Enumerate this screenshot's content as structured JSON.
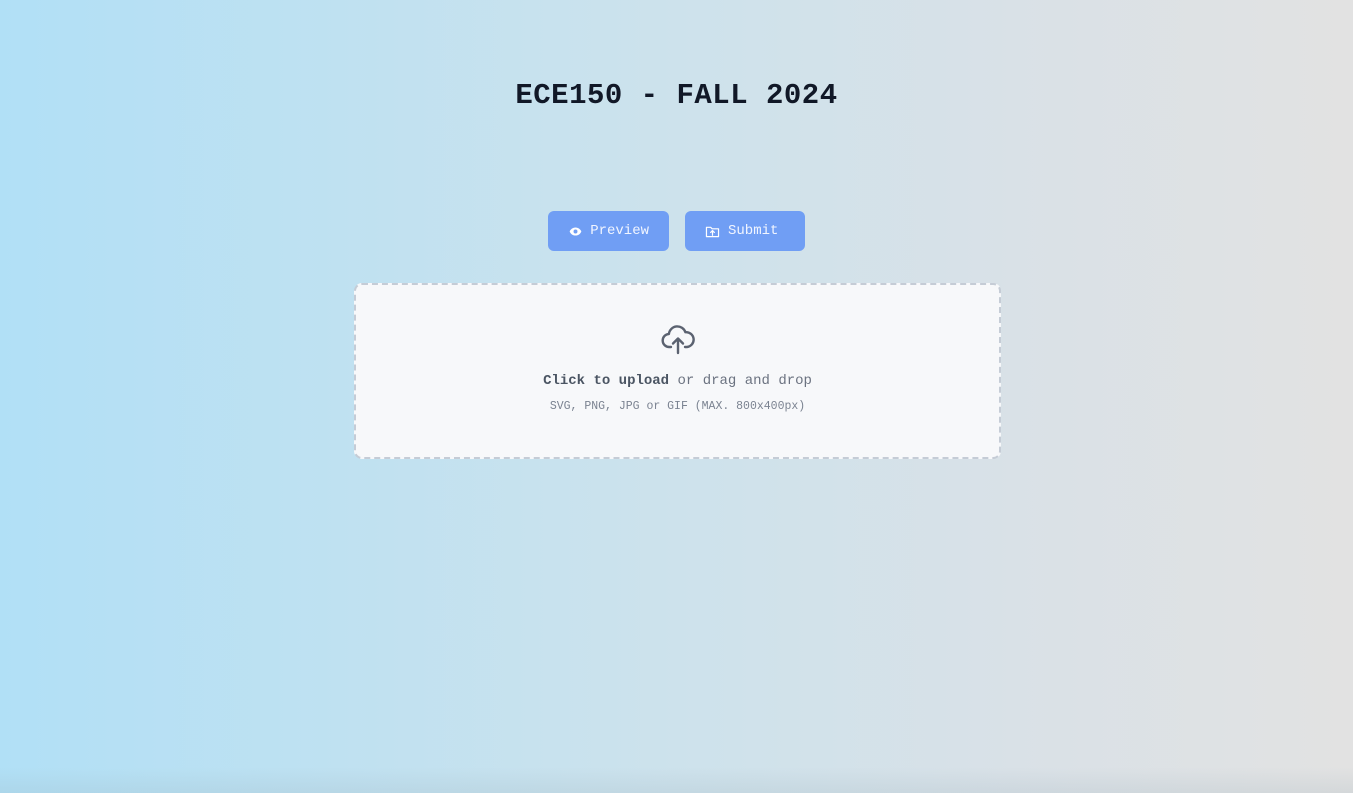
{
  "header": {
    "title": "ECE150 - FALL 2024"
  },
  "toolbar": {
    "preview_label": "Preview",
    "preview_icon": "eye-icon",
    "submit_label": "Submit",
    "submit_icon": "folder-upload-icon"
  },
  "upload": {
    "icon": "cloud-upload-icon",
    "click_text": "Click to upload",
    "drag_text": "or drag and drop",
    "hint": "SVG, PNG, JPG or GIF (MAX. 800x400px)"
  },
  "colors": {
    "button_bg": "#709ef4",
    "title_text": "#111827",
    "dropzone_bg": "#f7f8fa",
    "dropzone_border": "#c5ccd6"
  }
}
